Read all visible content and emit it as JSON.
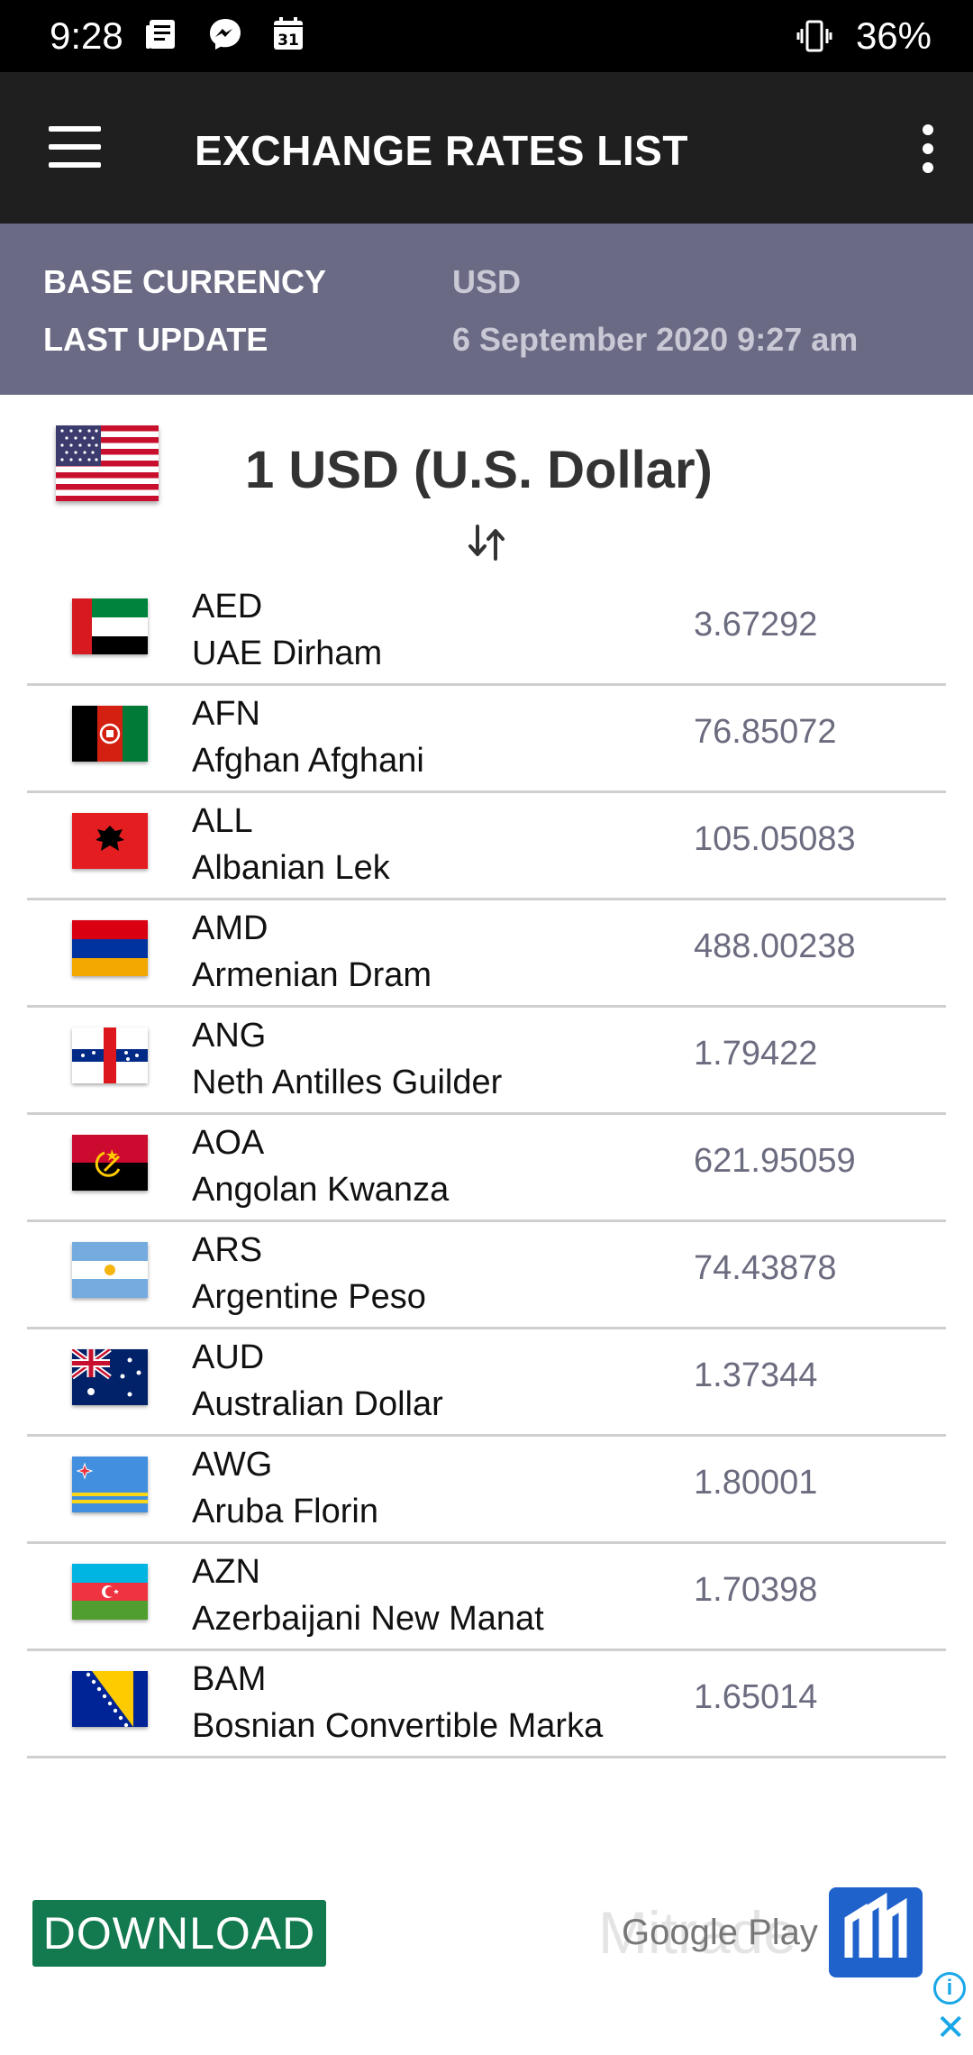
{
  "status_bar": {
    "time": "9:28",
    "battery": "36%",
    "icons": [
      "news-icon",
      "messenger-icon",
      "calendar-icon",
      "vibrate-icon"
    ],
    "calendar_day": "31"
  },
  "app_bar": {
    "title": "EXCHANGE RATES LIST"
  },
  "info": {
    "base_currency_label": "BASE CURRENCY",
    "base_currency_value": "USD",
    "last_update_label": "LAST UPDATE",
    "last_update_value": "6 September 2020 9:27 am"
  },
  "base": {
    "title": "1 USD (U.S. Dollar)"
  },
  "rates": [
    {
      "code": "AED",
      "name": "UAE Dirham",
      "value": "3.67292"
    },
    {
      "code": "AFN",
      "name": "Afghan Afghani",
      "value": "76.85072"
    },
    {
      "code": "ALL",
      "name": "Albanian Lek",
      "value": "105.05083"
    },
    {
      "code": "AMD",
      "name": "Armenian Dram",
      "value": "488.00238"
    },
    {
      "code": "ANG",
      "name": "Neth Antilles Guilder",
      "value": "1.79422"
    },
    {
      "code": "AOA",
      "name": "Angolan Kwanza",
      "value": "621.95059"
    },
    {
      "code": "ARS",
      "name": "Argentine Peso",
      "value": "74.43878"
    },
    {
      "code": "AUD",
      "name": "Australian Dollar",
      "value": "1.37344"
    },
    {
      "code": "AWG",
      "name": "Aruba Florin",
      "value": "1.80001"
    },
    {
      "code": "AZN",
      "name": "Azerbaijani New Manat",
      "value": "1.70398"
    },
    {
      "code": "BAM",
      "name": "Bosnian Convertible Marka",
      "value": "1.65014"
    }
  ],
  "ad": {
    "download_label": "DOWNLOAD",
    "watermark": "Mitrade",
    "store_label": "Google Play",
    "info_glyph": "i",
    "close_glyph": "✕"
  },
  "colors": {
    "app_bar": "#1f1f1f",
    "info_band": "#6a6a84",
    "rate_value": "#6c6c80",
    "download_button": "#127a4e",
    "ad_logo": "#1f62cc"
  }
}
